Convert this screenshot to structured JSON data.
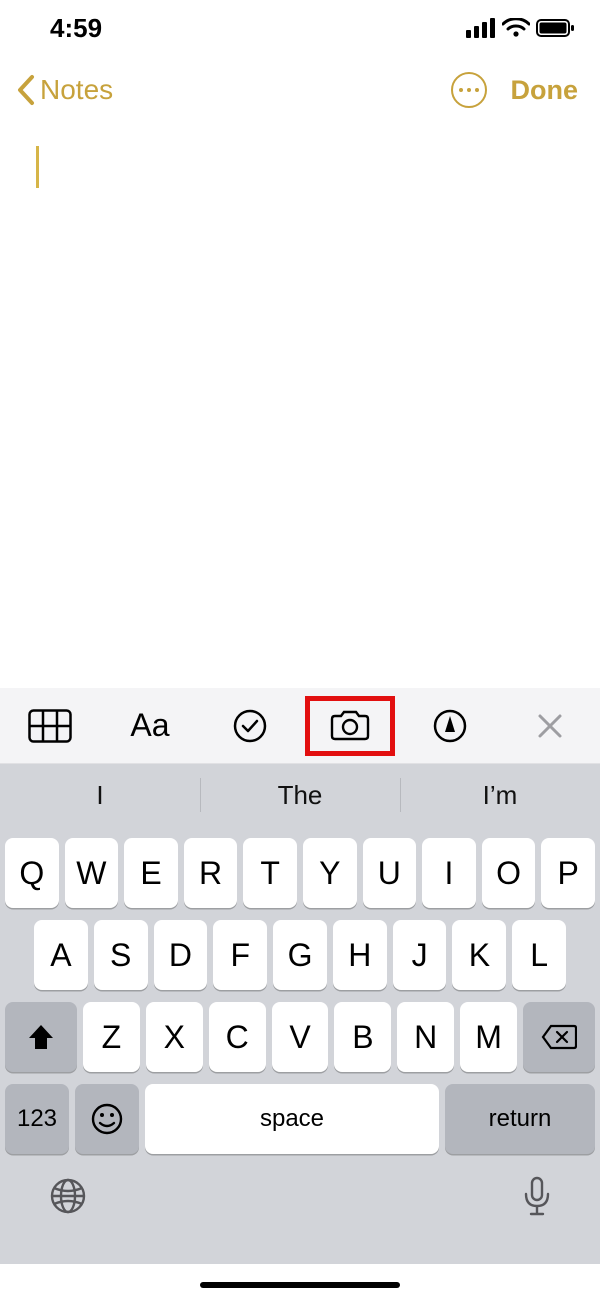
{
  "status": {
    "time": "4:59"
  },
  "nav": {
    "back_label": "Notes",
    "done_label": "Done"
  },
  "toolbar": {
    "aa_label": "Aa"
  },
  "predict": {
    "a": "I",
    "b": "The",
    "c": "I’m"
  },
  "keys": {
    "row1": [
      "Q",
      "W",
      "E",
      "R",
      "T",
      "Y",
      "U",
      "I",
      "O",
      "P"
    ],
    "row2": [
      "A",
      "S",
      "D",
      "F",
      "G",
      "H",
      "J",
      "K",
      "L"
    ],
    "row3": [
      "Z",
      "X",
      "C",
      "V",
      "B",
      "N",
      "M"
    ],
    "num": "123",
    "space": "space",
    "ret": "return"
  }
}
